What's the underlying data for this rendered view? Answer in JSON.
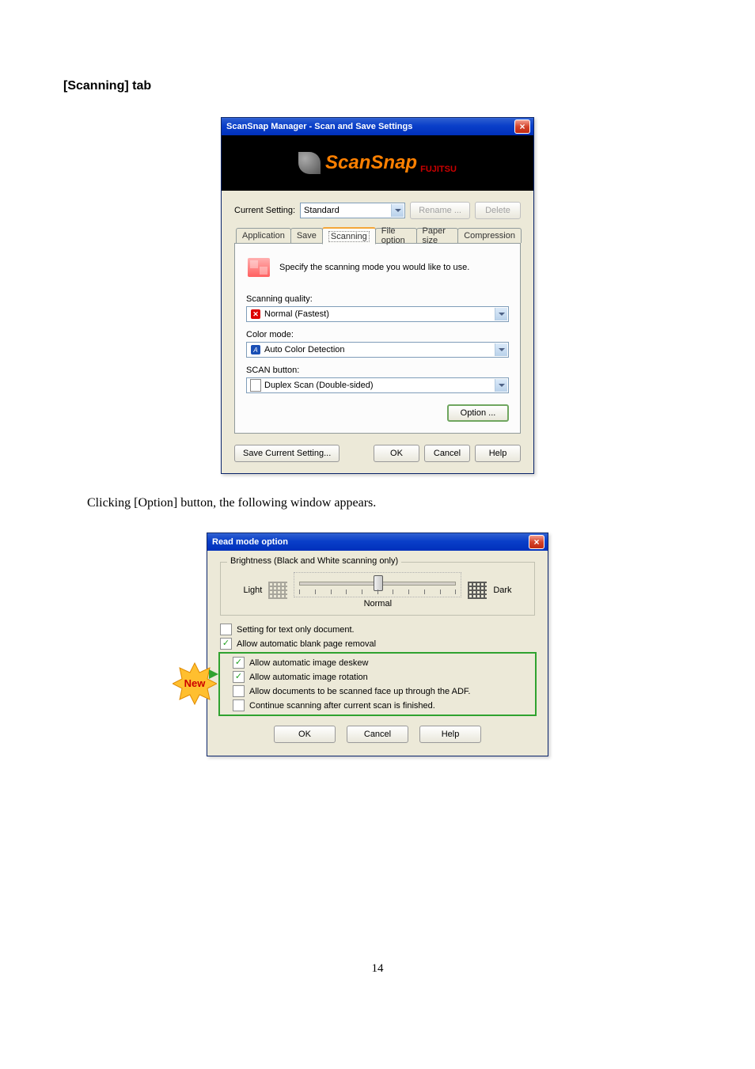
{
  "heading": "[Scanning] tab",
  "paragraph": "Clicking [Option] button, the following window appears.",
  "pagenum": "14",
  "dlg1": {
    "title": "ScanSnap Manager - Scan and Save Settings",
    "logo_main": "ScanSnap",
    "logo_sub": "FUJITSU",
    "current_setting_label": "Current Setting:",
    "current_setting_value": "Standard",
    "rename_btn": "Rename ...",
    "delete_btn": "Delete",
    "tabs": {
      "application": "Application",
      "save": "Save",
      "scanning": "Scanning",
      "file_option": "File option",
      "paper_size": "Paper size",
      "compression": "Compression"
    },
    "specify_text": "Specify the scanning mode you would like to use.",
    "sq_label": "Scanning quality:",
    "sq_value": "Normal (Fastest)",
    "cm_label": "Color mode:",
    "cm_value": "Auto Color Detection",
    "sb_label": "SCAN button:",
    "sb_value": "Duplex Scan (Double-sided)",
    "option_btn": "Option ...",
    "save_btn": "Save Current Setting...",
    "ok_btn": "OK",
    "cancel_btn": "Cancel",
    "help_btn": "Help"
  },
  "dlg2": {
    "title": "Read mode option",
    "fieldset_legend": "Brightness (Black and White scanning only)",
    "light": "Light",
    "dark": "Dark",
    "normal": "Normal",
    "chk_text_only": "Setting for text only document.",
    "chk_blank": "Allow automatic blank page removal",
    "chk_deskew": "Allow automatic image deskew",
    "chk_rotation": "Allow automatic image rotation",
    "chk_adf": "Allow documents to be scanned face up through the ADF.",
    "chk_continue": "Continue scanning after current scan is finished.",
    "ok": "OK",
    "cancel": "Cancel",
    "help": "Help",
    "new_badge": "New"
  }
}
